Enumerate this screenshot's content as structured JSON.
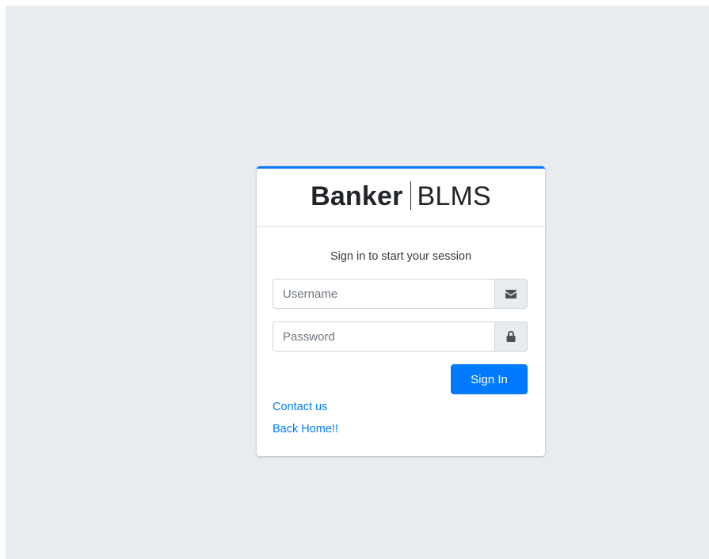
{
  "brand": {
    "bold": "Banker",
    "light": "BLMS"
  },
  "login": {
    "message": "Sign in to start your session",
    "username_placeholder": "Username",
    "password_placeholder": "Password",
    "signin_label": "Sign In",
    "username_icon": "envelope-icon",
    "password_icon": "lock-icon"
  },
  "links": {
    "contact": "Contact us",
    "home": "Back Home!!"
  },
  "colors": {
    "accent": "#007bff",
    "page_background": "#e9ecef",
    "card_background": "#ffffff"
  }
}
